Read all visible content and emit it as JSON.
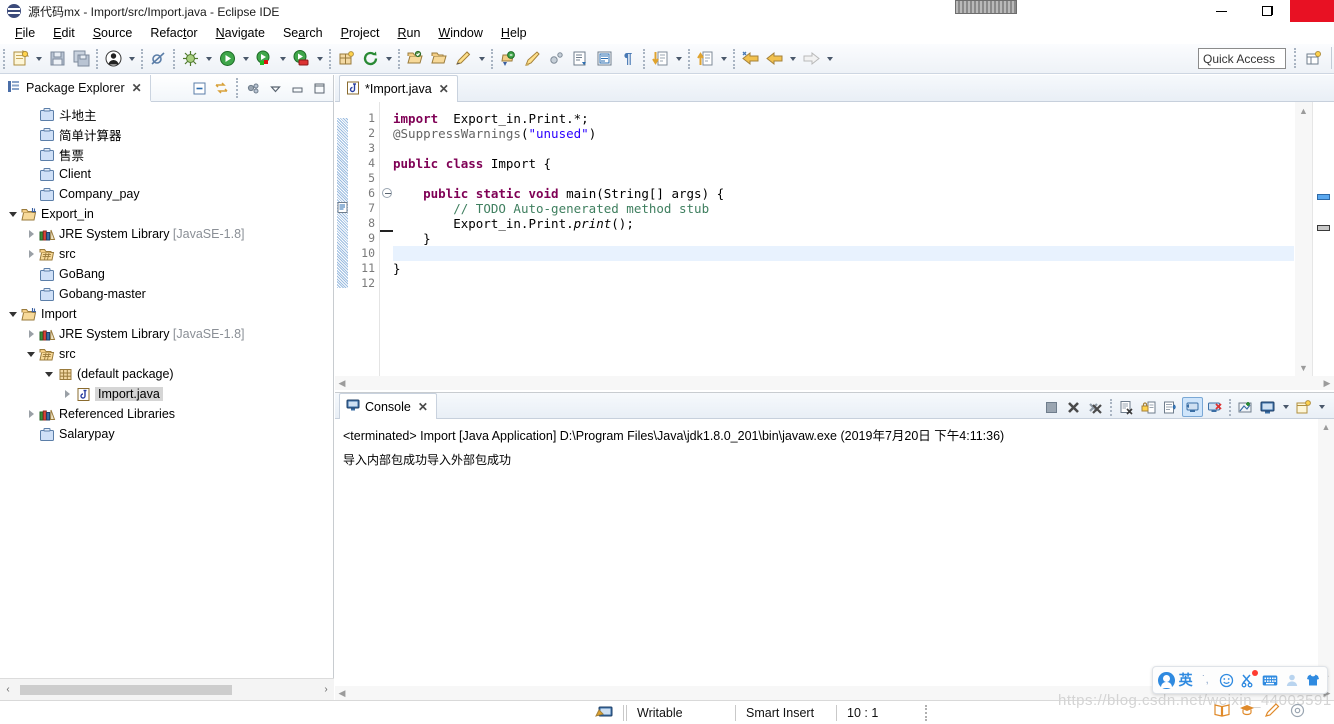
{
  "window": {
    "title": "源代码mx - Import/src/Import.java - Eclipse IDE",
    "app_icon": "eclipse-icon",
    "minimize_label": "—",
    "restore_label": "❐",
    "close_label": ""
  },
  "menubar": {
    "items": [
      {
        "label": "File",
        "mnemonic": "F"
      },
      {
        "label": "Edit",
        "mnemonic": "E"
      },
      {
        "label": "Source",
        "mnemonic": "S"
      },
      {
        "label": "Refactor",
        "mnemonic": "t"
      },
      {
        "label": "Navigate",
        "mnemonic": "N"
      },
      {
        "label": "Search",
        "mnemonic": "a"
      },
      {
        "label": "Project",
        "mnemonic": "P"
      },
      {
        "label": "Run",
        "mnemonic": "R"
      },
      {
        "label": "Window",
        "mnemonic": "W"
      },
      {
        "label": "Help",
        "mnemonic": "H"
      }
    ]
  },
  "toolbar": {
    "buttons": [
      "new-wizard-icon",
      "save-icon",
      "save-all-icon",
      "skip-breakpoints-icon",
      "debug-icon",
      "run-icon",
      "run-external-tools-icon",
      "run-coverage-icon",
      "new-java-package-icon",
      "refresh-icon",
      "open-type-icon",
      "open-task-icon",
      "edit-icon",
      "search-icon",
      "pencil-icon",
      "annotation-icon",
      "next-edit-icon",
      "outline-icon",
      "paragraph-icon",
      "next-annotation-icon",
      "previous-annotation-icon",
      "back-icon",
      "forward-icon"
    ],
    "quick_access_placeholder": "Quick Access",
    "perspective_button": "open-perspective-icon"
  },
  "explorer": {
    "tab_title": "Package Explorer",
    "tab_icon": "package-explorer-icon",
    "close_icon": "✕",
    "tools": [
      "collapse-all-icon",
      "link-with-editor-icon",
      "view-menu-icon",
      "minimize-icon",
      "maximize-icon"
    ],
    "tree": [
      {
        "indent": 1,
        "twist": "none",
        "icon": "project-closed-icon",
        "label": "斗地主",
        "suffix": ""
      },
      {
        "indent": 1,
        "twist": "none",
        "icon": "project-closed-icon",
        "label": "简单计算器",
        "suffix": ""
      },
      {
        "indent": 1,
        "twist": "none",
        "icon": "project-closed-icon",
        "label": "售票",
        "suffix": ""
      },
      {
        "indent": 1,
        "twist": "none",
        "icon": "project-closed-icon",
        "label": "Client",
        "suffix": ""
      },
      {
        "indent": 1,
        "twist": "none",
        "icon": "project-closed-icon",
        "label": "Company_pay",
        "suffix": ""
      },
      {
        "indent": 0,
        "twist": "open",
        "icon": "java-project-icon",
        "label": "Export_in",
        "suffix": ""
      },
      {
        "indent": 1,
        "twist": "closed",
        "icon": "jre-library-icon",
        "label": "JRE System Library",
        "suffix": "[JavaSE-1.8]"
      },
      {
        "indent": 1,
        "twist": "closed",
        "icon": "source-folder-icon",
        "label": "src",
        "suffix": ""
      },
      {
        "indent": 1,
        "twist": "none",
        "icon": "project-closed-icon",
        "label": "GoBang",
        "suffix": ""
      },
      {
        "indent": 1,
        "twist": "none",
        "icon": "project-closed-icon",
        "label": "Gobang-master",
        "suffix": ""
      },
      {
        "indent": 0,
        "twist": "open",
        "icon": "java-project-icon",
        "label": "Import",
        "suffix": ""
      },
      {
        "indent": 1,
        "twist": "closed",
        "icon": "jre-library-icon",
        "label": "JRE System Library",
        "suffix": "[JavaSE-1.8]"
      },
      {
        "indent": 1,
        "twist": "open",
        "icon": "source-folder-icon",
        "label": "src",
        "suffix": ""
      },
      {
        "indent": 2,
        "twist": "open",
        "icon": "package-icon",
        "label": "(default package)",
        "suffix": ""
      },
      {
        "indent": 3,
        "twist": "closed",
        "icon": "java-file-icon",
        "label": "Import.java",
        "suffix": "",
        "selected": true
      },
      {
        "indent": 1,
        "twist": "closed",
        "icon": "referenced-libraries-icon",
        "label": "Referenced Libraries",
        "suffix": ""
      },
      {
        "indent": 1,
        "twist": "none",
        "icon": "project-closed-icon",
        "label": "Salarypay",
        "suffix": ""
      }
    ]
  },
  "editor": {
    "tab_title": "*Import.java",
    "tab_icon": "java-file-icon",
    "close_icon": "✕",
    "lines": [
      {
        "n": 1,
        "fold": "",
        "html": "<span class=\"k\">import</span>  Export_in.Print.*;"
      },
      {
        "n": 2,
        "fold": "",
        "html": "<span class=\"a\">@SuppressWarnings</span>(<span class=\"s\">\"unused\"</span>)"
      },
      {
        "n": 3,
        "fold": "",
        "html": ""
      },
      {
        "n": 4,
        "fold": "",
        "html": "<span class=\"k\">public</span> <span class=\"k\">class</span> Import {"
      },
      {
        "n": 5,
        "fold": "",
        "html": ""
      },
      {
        "n": 6,
        "fold": "minus",
        "html": "    <span class=\"k\">public</span> <span class=\"k\">static</span> <span class=\"k\">void</span> main(String[] args) {"
      },
      {
        "n": 7,
        "fold": "",
        "html": "        <span class=\"c\">// TODO Auto-generated method stub</span>"
      },
      {
        "n": 8,
        "fold": "",
        "html": "        Export_in.Print.<span class=\"it\">print</span>();"
      },
      {
        "n": 9,
        "fold": "",
        "html": "    }"
      },
      {
        "n": 10,
        "fold": "",
        "html": "",
        "highlight": true
      },
      {
        "n": 11,
        "fold": "",
        "html": "}"
      },
      {
        "n": 12,
        "fold": "",
        "html": ""
      }
    ]
  },
  "console": {
    "tab_title": "Console",
    "tab_icon": "console-icon",
    "close_icon": "✕",
    "tools": [
      "terminate-icon",
      "remove-launch-icon",
      "remove-all-terminated-icon",
      "clear-console-icon",
      "scroll-lock-icon",
      "word-wrap-icon",
      "show-console-on-output-icon",
      "show-console-on-error-icon",
      "pin-console-icon",
      "display-selected-console-icon",
      "open-console-icon"
    ],
    "header": "<terminated> Import [Java Application] D:\\Program Files\\Java\\jdk1.8.0_201\\bin\\javaw.exe (2019年7月20日 下午4:11:36)",
    "output": "导入内部包成功导入外部包成功"
  },
  "statusbar": {
    "icon": "writable-state-icon",
    "writable": "Writable",
    "insert_mode": "Smart Insert",
    "cursor_position": "10 : 1"
  },
  "ime": {
    "logo": "qq-pinyin-logo-icon",
    "mode": "英",
    "items": [
      "punctuation-icon",
      "emoji-icon",
      "screenshot-icon",
      "soft-keyboard-icon",
      "user-icon",
      "skin-icon"
    ]
  },
  "watermark": "https://blog.csdn.net/weixin_44003591",
  "colors": {
    "accent": "#2f8ae0",
    "keyword": "#7f0055",
    "string": "#2a00ff",
    "comment": "#3f7f5f",
    "annotation": "#646464",
    "close_button": "#e81123",
    "selection": "#d5d5d5",
    "current_line": "#e8f2fe"
  }
}
